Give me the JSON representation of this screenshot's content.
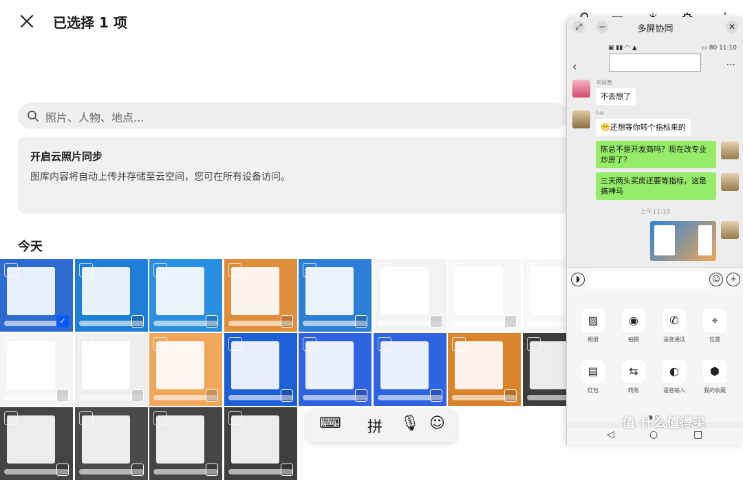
{
  "gallery": {
    "title": "已选择 1 项",
    "search_placeholder": "照片、人物、地点...",
    "cloud_sync": {
      "title": "开启云照片同步",
      "description": "图库内容将自动上传并存储至云空间，您可在所有设备访问。"
    },
    "section_today": "今天",
    "thumbnails": [
      {
        "bg": "#2e6bd1",
        "selected": true
      },
      {
        "bg": "#1f7fd8",
        "selected": false
      },
      {
        "bg": "#2a8fe0",
        "selected": false
      },
      {
        "bg": "#e08e3a",
        "selected": false
      },
      {
        "bg": "#2c7fd4",
        "selected": false
      },
      {
        "bg": "#f3f3f3",
        "selected": false
      },
      {
        "bg": "#f7f7f7",
        "selected": false
      },
      {
        "bg": "#f7f7f7",
        "selected": false
      },
      {
        "bg": "#f5f5f5",
        "selected": false
      },
      {
        "bg": "#eeeeee",
        "selected": false
      },
      {
        "bg": "#f0a75a",
        "selected": false
      },
      {
        "bg": "#1c5fd6",
        "selected": false
      },
      {
        "bg": "#2f63e0",
        "selected": false
      },
      {
        "bg": "#2f63e0",
        "selected": false
      },
      {
        "bg": "#d9842a",
        "selected": false
      },
      {
        "bg": "#3d3d3d",
        "selected": false
      },
      {
        "bg": "#444444",
        "selected": false
      },
      {
        "bg": "#4a4a4a",
        "selected": false
      },
      {
        "bg": "#454545",
        "selected": false
      },
      {
        "bg": "#3f3f3f",
        "selected": false
      }
    ]
  },
  "ime_toolbar": {
    "keyboard_icon": "keyboard-icon",
    "pinyin_label": "拼",
    "mic_icon": "microphone-icon",
    "emoji_icon": "emoji-icon"
  },
  "multiscreen": {
    "title": "多屏协同",
    "status_time": "11:10",
    "status_battery": "80",
    "messages": [
      {
        "side": "left",
        "sender": "韦探真",
        "text": "不去想了"
      },
      {
        "side": "left",
        "sender": "hai",
        "text": "😬还想等你转个指标来的"
      },
      {
        "side": "right",
        "text": "陈总不是开发商吗？现在改专业炒房了？"
      },
      {
        "side": "right",
        "text": "三天两头买房还要等指标，这是搞神马"
      }
    ],
    "timestamp": "上午11:10",
    "tools": [
      {
        "label": "相册",
        "icon": "image-icon"
      },
      {
        "label": "拍摄",
        "icon": "camera-icon"
      },
      {
        "label": "语音通话",
        "icon": "phone-icon"
      },
      {
        "label": "位置",
        "icon": "location-icon"
      },
      {
        "label": "红包",
        "icon": "red-packet-icon"
      },
      {
        "label": "转账",
        "icon": "transfer-icon"
      },
      {
        "label": "语音输入",
        "icon": "mic-icon"
      },
      {
        "label": "我的收藏",
        "icon": "box-icon"
      }
    ]
  },
  "watermark": "值 什么值得买",
  "colors": {
    "accent": "#0a59f7",
    "wechat_green": "#95ec69"
  }
}
